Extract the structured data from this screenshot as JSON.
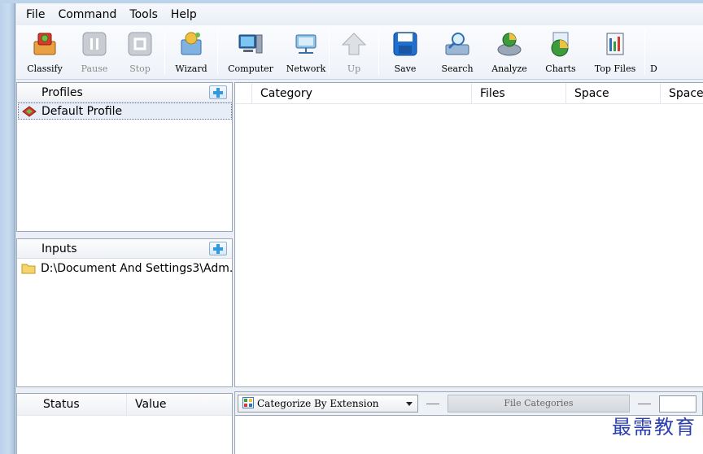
{
  "menu": [
    "File",
    "Command",
    "Tools",
    "Help"
  ],
  "toolbar": {
    "items": [
      {
        "label": "Classify",
        "icon": "classify-icon",
        "enabled": true
      },
      {
        "label": "Pause",
        "icon": "pause-icon",
        "enabled": false
      },
      {
        "label": "Stop",
        "icon": "stop-icon",
        "enabled": false
      },
      {
        "label": "Wizard",
        "icon": "wizard-icon",
        "enabled": true
      },
      {
        "label": "Computer",
        "icon": "computer-icon",
        "enabled": true
      },
      {
        "label": "Network",
        "icon": "network-icon",
        "enabled": true
      },
      {
        "label": "Up",
        "icon": "up-arrow-icon",
        "enabled": false
      },
      {
        "label": "Save",
        "icon": "save-icon",
        "enabled": true
      },
      {
        "label": "Search",
        "icon": "search-icon",
        "enabled": true
      },
      {
        "label": "Analyze",
        "icon": "analyze-icon",
        "enabled": true
      },
      {
        "label": "Charts",
        "icon": "charts-icon",
        "enabled": true
      },
      {
        "label": "Top Files",
        "icon": "top-files-icon",
        "enabled": true
      },
      {
        "label": "D",
        "icon": "truncated-icon",
        "enabled": true
      }
    ]
  },
  "profiles": {
    "header": "Profiles",
    "items": [
      {
        "label": "Default Profile",
        "selected": true
      }
    ]
  },
  "inputs": {
    "header": "Inputs",
    "items": [
      {
        "label": "D:\\Document And Settings3\\Adm..."
      }
    ]
  },
  "status": {
    "col_status": "Status",
    "col_value": "Value"
  },
  "main_grid": {
    "columns": [
      "Category",
      "Files",
      "Space",
      "Space"
    ]
  },
  "bottom": {
    "combo_value": "Categorize By Extension",
    "file_categories_label": "File Categories"
  },
  "watermark": "最需教育",
  "colors": {
    "accent": "#3399dd",
    "disabled_text": "#8c8c8c",
    "selection_bg": "#e7eef8"
  }
}
